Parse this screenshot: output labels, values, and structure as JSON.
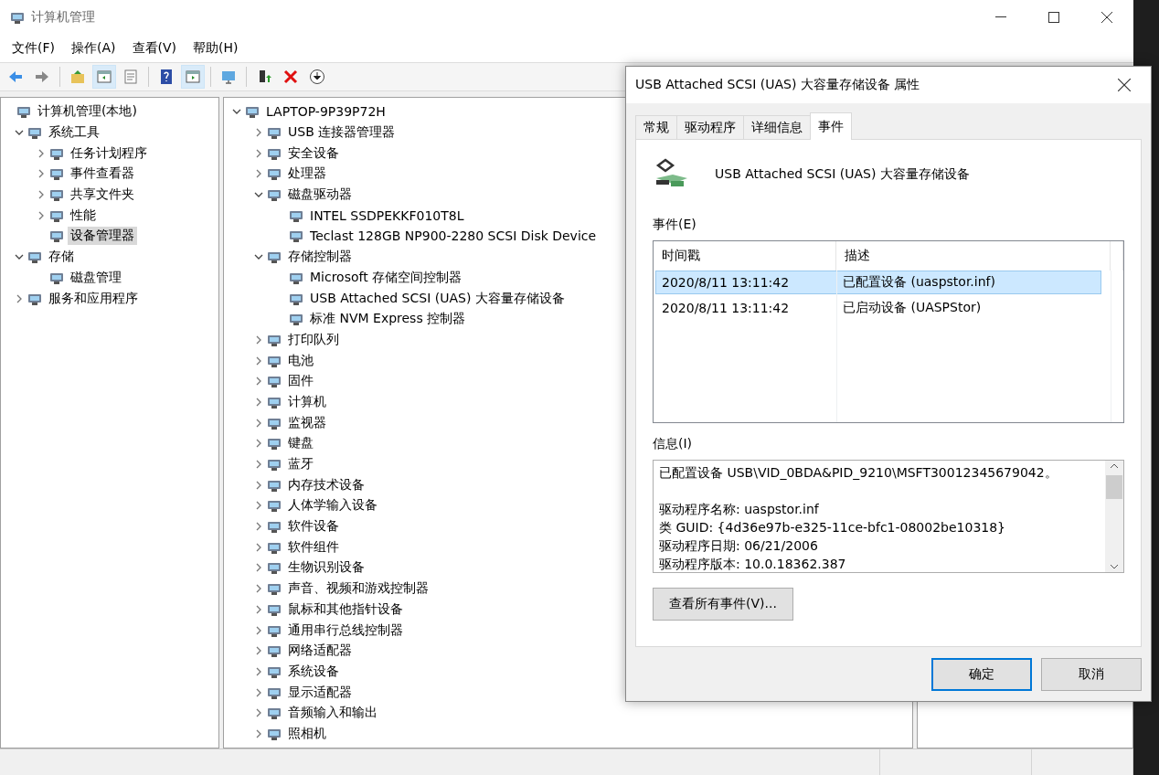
{
  "window": {
    "title": "计算机管理"
  },
  "menu": [
    "文件(F)",
    "操作(A)",
    "查看(V)",
    "帮助(H)"
  ],
  "toolbar": [
    {
      "pressed": false
    },
    {
      "pressed": false
    },
    {
      "pressed": false
    },
    {
      "pressed": true
    },
    {
      "pressed": false
    },
    {
      "pressed": false
    },
    {
      "pressed": true
    },
    {
      "pressed": false
    },
    {
      "pressed": false
    },
    {
      "pressed": false
    },
    {
      "pressed": false
    }
  ],
  "console_tree": [
    {
      "label": "计算机管理(本地)",
      "selected": false,
      "children": [
        {
          "label": "系统工具",
          "expanded": true,
          "selected": false,
          "children": [
            {
              "label": "任务计划程序",
              "expanded": false,
              "selected": false
            },
            {
              "label": "事件查看器",
              "expanded": false,
              "selected": false
            },
            {
              "label": "共享文件夹",
              "expanded": false,
              "selected": false
            },
            {
              "label": "性能",
              "expanded": false,
              "selected": false
            },
            {
              "label": "设备管理器",
              "selected": true
            }
          ]
        },
        {
          "label": "存储",
          "expanded": true,
          "selected": false,
          "children": [
            {
              "label": "磁盘管理",
              "selected": false
            }
          ]
        },
        {
          "label": "服务和应用程序",
          "expanded": false,
          "selected": false
        }
      ]
    }
  ],
  "device_tree": [
    {
      "label": "LAPTOP-9P39P72H",
      "expanded": true,
      "children": [
        {
          "label": "USB 连接器管理器",
          "expanded": false
        },
        {
          "label": "安全设备",
          "expanded": false
        },
        {
          "label": "处理器",
          "expanded": false
        },
        {
          "label": "磁盘驱动器",
          "expanded": true,
          "children": [
            {
              "label": "INTEL SSDPEKKF010T8L"
            },
            {
              "label": "Teclast 128GB NP900-2280 SCSI Disk Device"
            }
          ]
        },
        {
          "label": "存储控制器",
          "expanded": true,
          "children": [
            {
              "label": "Microsoft 存储空间控制器"
            },
            {
              "label": "USB Attached SCSI (UAS) 大容量存储设备"
            },
            {
              "label": "标准 NVM Express 控制器"
            }
          ]
        },
        {
          "label": "打印队列",
          "expanded": false
        },
        {
          "label": "电池",
          "expanded": false
        },
        {
          "label": "固件",
          "expanded": false
        },
        {
          "label": "计算机",
          "expanded": false
        },
        {
          "label": "监视器",
          "expanded": false
        },
        {
          "label": "键盘",
          "expanded": false
        },
        {
          "label": "蓝牙",
          "expanded": false
        },
        {
          "label": "内存技术设备",
          "expanded": false
        },
        {
          "label": "人体学输入设备",
          "expanded": false
        },
        {
          "label": "软件设备",
          "expanded": false
        },
        {
          "label": "软件组件",
          "expanded": false
        },
        {
          "label": "生物识别设备",
          "expanded": false
        },
        {
          "label": "声音、视频和游戏控制器",
          "expanded": false
        },
        {
          "label": "鼠标和其他指针设备",
          "expanded": false
        },
        {
          "label": "通用串行总线控制器",
          "expanded": false
        },
        {
          "label": "网络适配器",
          "expanded": false
        },
        {
          "label": "系统设备",
          "expanded": false
        },
        {
          "label": "显示适配器",
          "expanded": false
        },
        {
          "label": "音频输入和输出",
          "expanded": false
        },
        {
          "label": "照相机",
          "expanded": false
        }
      ]
    }
  ],
  "dialog": {
    "title": "USB Attached SCSI (UAS) 大容量存储设备 属性",
    "tabs": [
      {
        "label": "常规",
        "selected": false
      },
      {
        "label": "驱动程序",
        "selected": false
      },
      {
        "label": "详细信息",
        "selected": false
      },
      {
        "label": "事件",
        "selected": true
      }
    ],
    "device_name": "USB Attached SCSI (UAS) 大容量存储设备",
    "events_label": "事件(E)",
    "columns": [
      "时间戳",
      "描述"
    ],
    "rows": [
      {
        "cells": [
          "2020/8/11 13:11:42",
          "已配置设备 (uaspstor.inf)"
        ],
        "selected": true
      },
      {
        "cells": [
          "2020/8/11 13:11:42",
          "已启动设备 (UASPStor)"
        ],
        "selected": false
      }
    ],
    "info_label": "信息(I)",
    "info_paragraphs": [
      [
        "已配置设备 USB\\VID_0BDA&PID_9210\\MSFT30012345679042。"
      ],
      [
        "驱动程序名称: uaspstor.inf",
        "类 GUID: {4d36e97b-e325-11ce-bfc1-08002be10318}",
        "驱动程序日期: 06/21/2006",
        "驱动程序版本: 10.0.18362.387"
      ]
    ],
    "view_all_button": "查看所有事件(V)...",
    "buttons": [
      {
        "label": "确定",
        "default": true
      },
      {
        "label": "取消",
        "default": false
      }
    ]
  }
}
